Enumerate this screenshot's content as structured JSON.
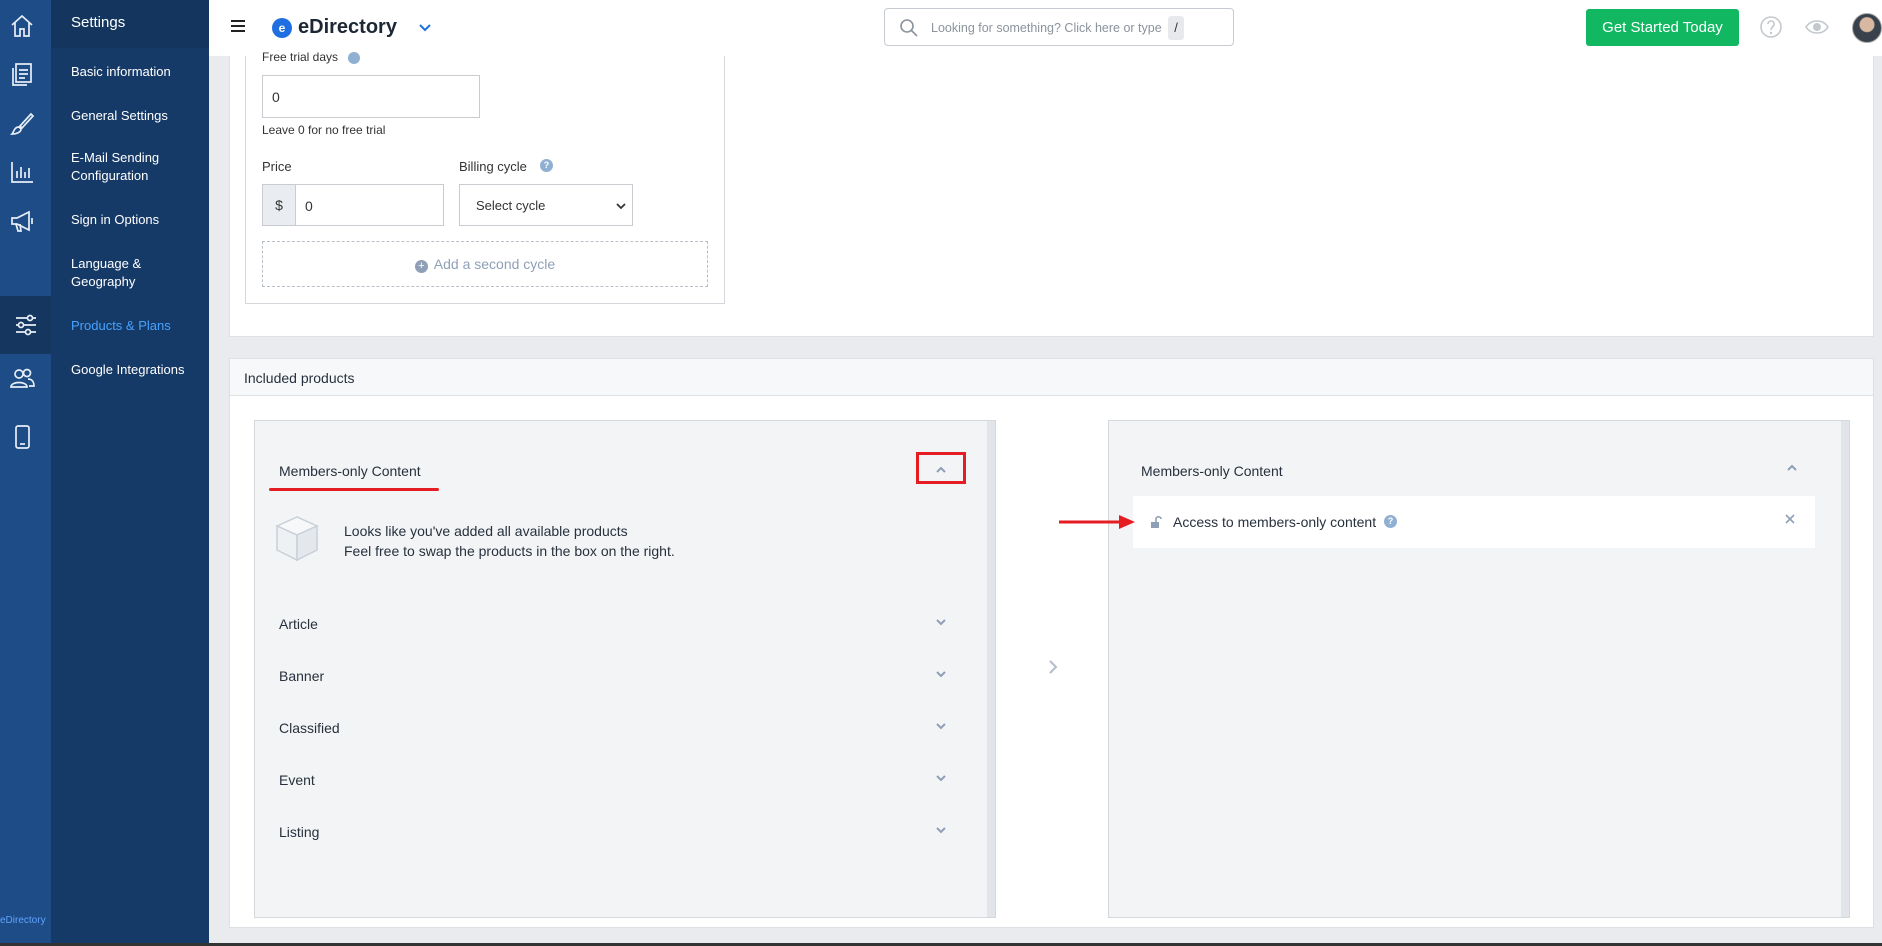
{
  "rail": {
    "icons": [
      "home-icon",
      "documents-icon",
      "brush-icon",
      "chart-icon",
      "megaphone-icon",
      "settings-sliders-icon",
      "users-icon",
      "mobile-icon"
    ],
    "brand": "eDirectory"
  },
  "menu": {
    "title": "Settings",
    "items": [
      {
        "label": "Basic information",
        "active": false
      },
      {
        "label": "General Settings",
        "active": false
      },
      {
        "label": "E-Mail Sending Configuration",
        "active": false
      },
      {
        "label": "Sign in Options",
        "active": false
      },
      {
        "label": "Language & Geography",
        "active": false
      },
      {
        "label": "Products & Plans",
        "active": true
      },
      {
        "label": "Google Integrations",
        "active": false
      }
    ]
  },
  "topbar": {
    "logo_mark": "e",
    "logo_text": "eDirectory",
    "search_placeholder": "Looking for something? Click here or type",
    "search_shortcut": "/",
    "cta_label": "Get Started Today",
    "cta_color": "#12b861"
  },
  "plan_form": {
    "trial_label_cut": "Free trial days",
    "trial_value": "0",
    "trial_hint": "Leave 0 for no free trial",
    "price_label": "Price",
    "currency_symbol": "$",
    "price_value": "0",
    "billing_label": "Billing cycle",
    "billing_selected": "Select cycle",
    "add_cycle_label": "Add a second cycle"
  },
  "included_products": {
    "header": "Included products",
    "left_panel": {
      "section_title": "Members-only Content",
      "empty_title": "Looks like you've added all available products",
      "empty_subtitle": "Feel free to swap the products in the box on the right.",
      "categories": [
        "Article",
        "Banner",
        "Classified",
        "Event",
        "Listing"
      ]
    },
    "right_panel": {
      "section_title": "Members-only Content",
      "items": [
        {
          "label": "Access to members-only content"
        }
      ]
    }
  },
  "annotations": {
    "highlight_color": "#e51d22"
  }
}
